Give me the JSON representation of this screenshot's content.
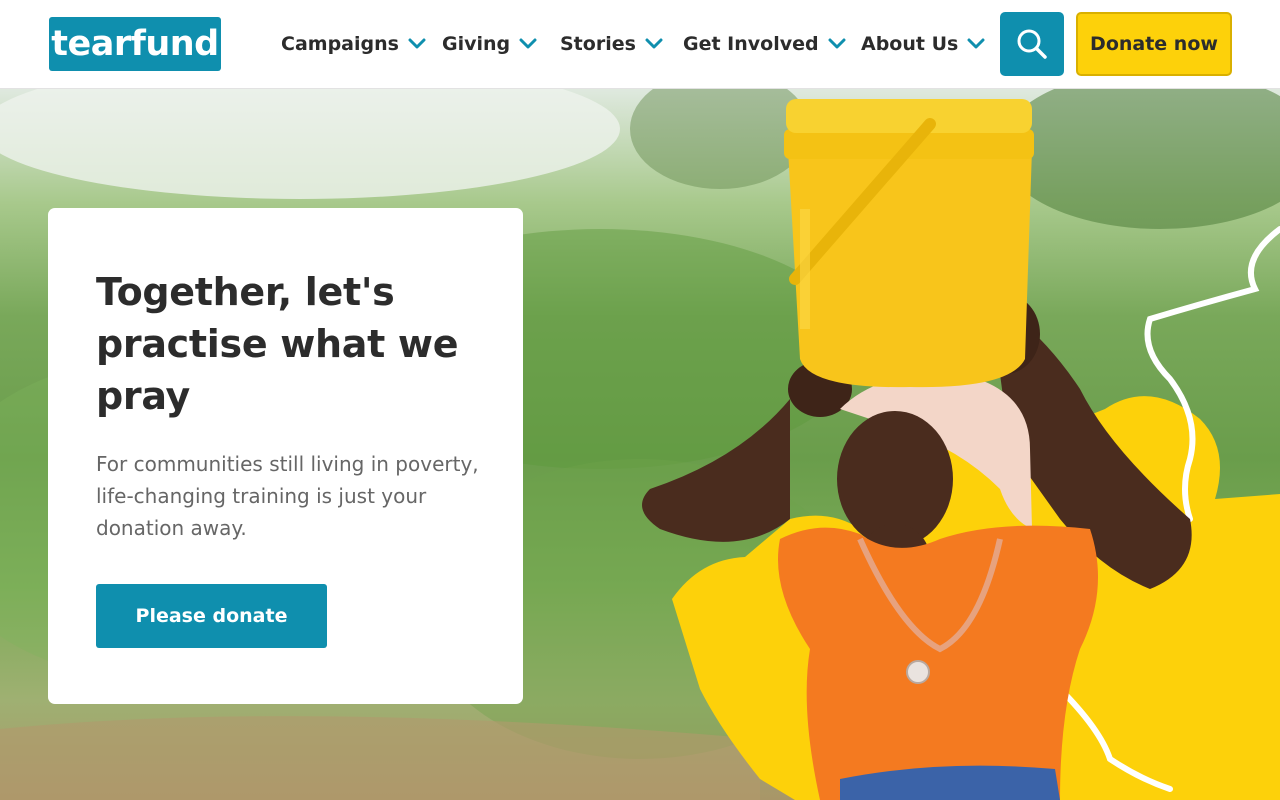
{
  "header": {
    "logo_text": "tearfund",
    "nav": [
      {
        "label": "Campaigns"
      },
      {
        "label": "Giving"
      },
      {
        "label": "Stories"
      },
      {
        "label": "Get Involved"
      },
      {
        "label": "About Us"
      }
    ],
    "donate_label": "Donate now"
  },
  "hero": {
    "heading": "Together, let's practise what we pray",
    "body": "For communities still living in poverty, life-changing training is just your donation away.",
    "cta_label": "Please donate"
  },
  "colors": {
    "brand_teal": "#0f8fae",
    "brand_yellow": "#fdd10a",
    "text_dark": "#2c2c2c",
    "text_muted": "#666666"
  }
}
